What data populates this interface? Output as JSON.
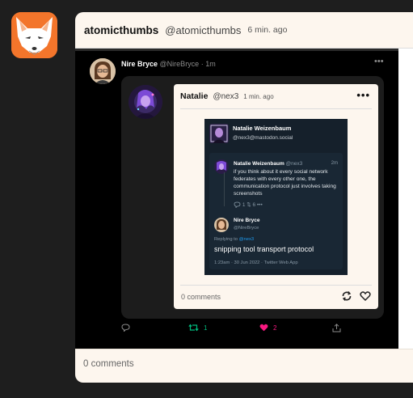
{
  "post": {
    "display_name": "atomicthumbs",
    "handle": "@atomicthumbs",
    "time": "6 min. ago",
    "comments": "0 comments"
  },
  "embedded_tweet": {
    "name": "Nire Bryce",
    "handle": "@NireBryce",
    "time": "· 1m",
    "retweets": "1",
    "likes": "2"
  },
  "inner_post": {
    "display_name": "Natalie",
    "handle": "@nex3",
    "time": "1 min. ago",
    "comments": "0 comments"
  },
  "screenshot": {
    "author_name": "Natalie Weizenbaum",
    "author_handle": "@nex3@mastodon.social",
    "quoted_name": "Natalie Weizenbaum",
    "quoted_handle": "@nex3",
    "quoted_time": "2m",
    "quoted_text": "if you think about it every social network federates with every other one, the communication protocol just involves taking screenshots",
    "quoted_stats": "1  ⇅  6  •••",
    "reply_name": "Nire Bryce",
    "reply_handle": "@NireBryce",
    "replying_prefix": "Replying to",
    "replying_to": "@nex3",
    "reply_text": "snipping tool transport protocol",
    "reply_meta": "1:23am · 30 Jun 2022 · Twitter Web App"
  },
  "colors": {
    "card_bg": "#fdf6ee",
    "fox_orange": "#f3752b",
    "retweet_green": "#00ba7c",
    "like_pink": "#f91880"
  },
  "icons": [
    "fox-logo",
    "more-dots-icon",
    "reply-icon",
    "retweet-icon",
    "heart-icon",
    "share-icon",
    "repost-icon"
  ]
}
